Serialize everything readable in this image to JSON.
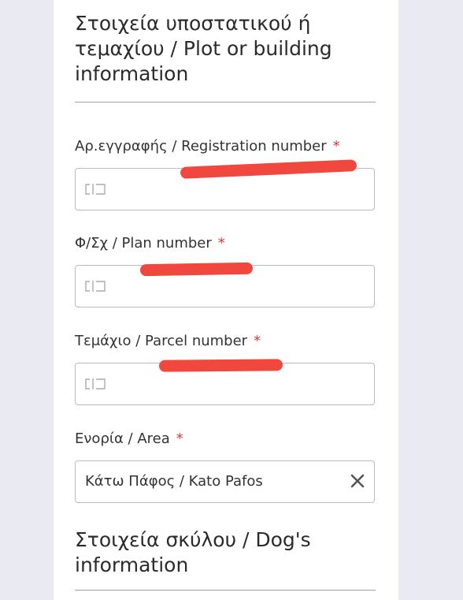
{
  "plot_section": {
    "title": "Στοιχεία υποστατικού ή τεμαχίου / Plot or building information"
  },
  "fields": {
    "registration": {
      "label": "Αρ.εγγραφής / Registration number",
      "required_mark": "*",
      "value": ""
    },
    "plan": {
      "label": "Φ/Σχ / Plan number",
      "required_mark": "*",
      "value": ""
    },
    "parcel": {
      "label": "Τεμάχιο / Parcel number",
      "required_mark": "*",
      "value": ""
    },
    "area": {
      "label": "Ενορία / Area",
      "required_mark": "*",
      "selected_value": "Κάτω Πάφος / Kato Pafos"
    }
  },
  "dog_section": {
    "title": "Στοιχεία σκύλου / Dog's information"
  },
  "icons": {
    "input_icon": "text-cursor-icon",
    "clear_icon": "close-icon"
  },
  "colors": {
    "required_asterisk": "#d93a3a",
    "redaction_mark": "#f0483e",
    "page_background": "#e9eaf2"
  }
}
